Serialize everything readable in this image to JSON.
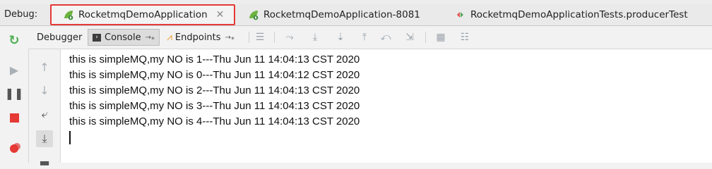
{
  "debug_label": "Debug:",
  "tabs": [
    {
      "label": "RocketmqDemoApplication",
      "active": true
    },
    {
      "label": "RocketmqDemoApplication-8081",
      "active": false
    },
    {
      "label": "RocketmqDemoApplicationTests.producerTest",
      "active": false
    }
  ],
  "toolbar": {
    "debugger_label": "Debugger",
    "console_label": "Console",
    "endpoints_label": "Endpoints"
  },
  "console": {
    "lines": [
      "this is simpleMQ,my NO is 1---Thu Jun 11 14:04:13 CST 2020",
      "this is simpleMQ,my NO is 0---Thu Jun 11 14:04:12 CST 2020",
      "this is simpleMQ,my NO is 2---Thu Jun 11 14:04:13 CST 2020",
      "this is simpleMQ,my NO is 3---Thu Jun 11 14:04:13 CST 2020",
      "this is simpleMQ,my NO is 4---Thu Jun 11 14:04:13 CST 2020"
    ]
  },
  "colors": {
    "highlight_border": "#e53935",
    "spring_green": "#6db33f",
    "stop_red": "#e53935"
  }
}
